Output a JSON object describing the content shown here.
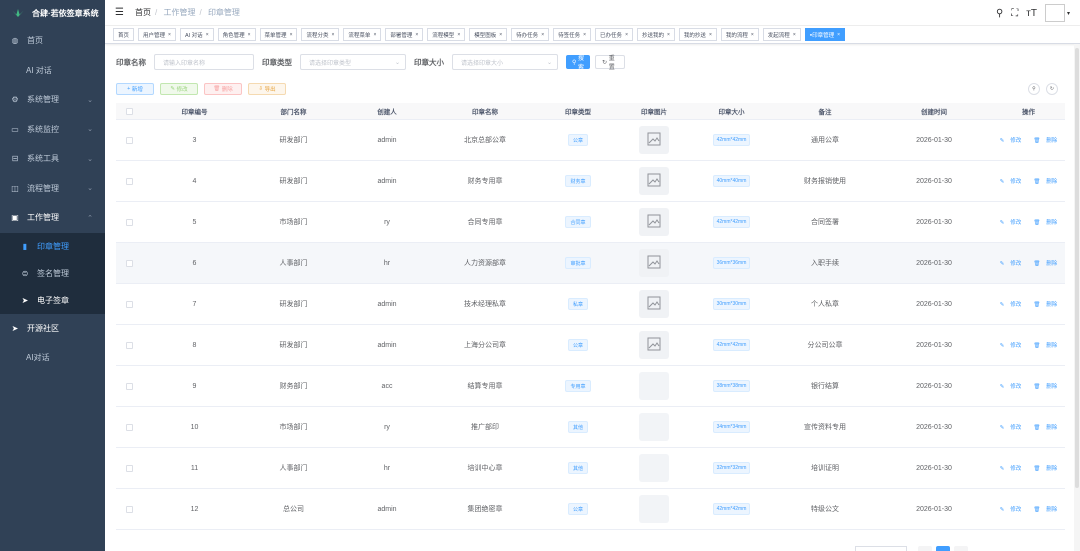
{
  "app": {
    "title": "合肆·若依签章系统"
  },
  "sidebar": {
    "items": [
      {
        "label": "首页",
        "icon": "dashboard-icon"
      },
      {
        "label": "AI 对话",
        "icon": ""
      },
      {
        "label": "系统管理",
        "icon": "gear-icon"
      },
      {
        "label": "系统监控",
        "icon": "monitor-icon"
      },
      {
        "label": "系统工具",
        "icon": "tool-icon"
      },
      {
        "label": "流程管理",
        "icon": "flow-icon"
      },
      {
        "label": "工作管理",
        "icon": "work-icon"
      },
      {
        "label": "印章管理",
        "icon": "seal-icon"
      },
      {
        "label": "签名管理",
        "icon": "signature-icon"
      },
      {
        "label": "电子签章",
        "icon": "send-icon"
      },
      {
        "label": "开源社区",
        "icon": "send-icon"
      },
      {
        "label": "AI对话",
        "icon": ""
      }
    ]
  },
  "breadcrumb": {
    "home": "首页",
    "level1": "工作管理",
    "current": "印章管理"
  },
  "tags": [
    "首页",
    "用户管理",
    "AI 对话",
    "角色管理",
    "菜单管理",
    "流程分类",
    "流程菜单",
    "部署管理",
    "流程模型",
    "模型图板",
    "待办任务",
    "待签任务",
    "已办任务",
    "抄送我的",
    "我的抄送",
    "我的流程",
    "发起流程",
    "印章管理"
  ],
  "search": {
    "name_label": "印章名称",
    "name_placeholder": "请输入印章名称",
    "type_label": "印章类型",
    "type_placeholder": "请选择印章类型",
    "size_label": "印章大小",
    "size_placeholder": "请选择印章大小",
    "search_btn": "搜索",
    "reset_btn": "重置"
  },
  "toolbar": {
    "add": "新增",
    "edit": "修改",
    "delete": "删除",
    "export": "导出"
  },
  "table": {
    "headers": [
      "印章编号",
      "部门名称",
      "创建人",
      "印章名称",
      "印章类型",
      "印章图片",
      "印章大小",
      "备注",
      "创建时间",
      "操作"
    ],
    "edit_label": "修改",
    "delete_label": "删除",
    "rows": [
      {
        "id": "3",
        "dept": "研发部门",
        "creator": "admin",
        "name": "北京总部公章",
        "type": "公章",
        "has_img": true,
        "size": "42mm*42mm",
        "remark": "通用公章",
        "date": "2026-01-30"
      },
      {
        "id": "4",
        "dept": "研发部门",
        "creator": "admin",
        "name": "财务专用章",
        "type": "财务章",
        "has_img": true,
        "size": "40mm*40mm",
        "remark": "财务报销使用",
        "date": "2026-01-30"
      },
      {
        "id": "5",
        "dept": "市场部门",
        "creator": "ry",
        "name": "合同专用章",
        "type": "合同章",
        "has_img": true,
        "size": "42mm*42mm",
        "remark": "合同签署",
        "date": "2026-01-30"
      },
      {
        "id": "6",
        "dept": "人事部门",
        "creator": "hr",
        "name": "人力资源部章",
        "type": "审批章",
        "has_img": true,
        "size": "36mm*36mm",
        "remark": "入职手续",
        "date": "2026-01-30"
      },
      {
        "id": "7",
        "dept": "研发部门",
        "creator": "admin",
        "name": "技术经理私章",
        "type": "私章",
        "has_img": true,
        "size": "30mm*30mm",
        "remark": "个人私章",
        "date": "2026-01-30"
      },
      {
        "id": "8",
        "dept": "研发部门",
        "creator": "admin",
        "name": "上海分公司章",
        "type": "公章",
        "has_img": true,
        "size": "42mm*42mm",
        "remark": "分公司公章",
        "date": "2026-01-30"
      },
      {
        "id": "9",
        "dept": "财务部门",
        "creator": "acc",
        "name": "结算专用章",
        "type": "专用章",
        "has_img": false,
        "size": "38mm*38mm",
        "remark": "银行结算",
        "date": "2026-01-30"
      },
      {
        "id": "10",
        "dept": "市场部门",
        "creator": "ry",
        "name": "推广部印",
        "type": "其他",
        "has_img": false,
        "size": "34mm*34mm",
        "remark": "宣传资料专用",
        "date": "2026-01-30"
      },
      {
        "id": "11",
        "dept": "人事部门",
        "creator": "hr",
        "name": "培训中心章",
        "type": "其他",
        "has_img": false,
        "size": "32mm*32mm",
        "remark": "培训证明",
        "date": "2026-01-30"
      },
      {
        "id": "12",
        "dept": "总公司",
        "creator": "admin",
        "name": "集团绝密章",
        "type": "公章",
        "has_img": false,
        "size": "42mm*42mm",
        "remark": "特级公文",
        "date": "2026-01-30"
      }
    ]
  },
  "colors": {
    "sidebar_bg": "#304156",
    "accent": "#409eff"
  }
}
